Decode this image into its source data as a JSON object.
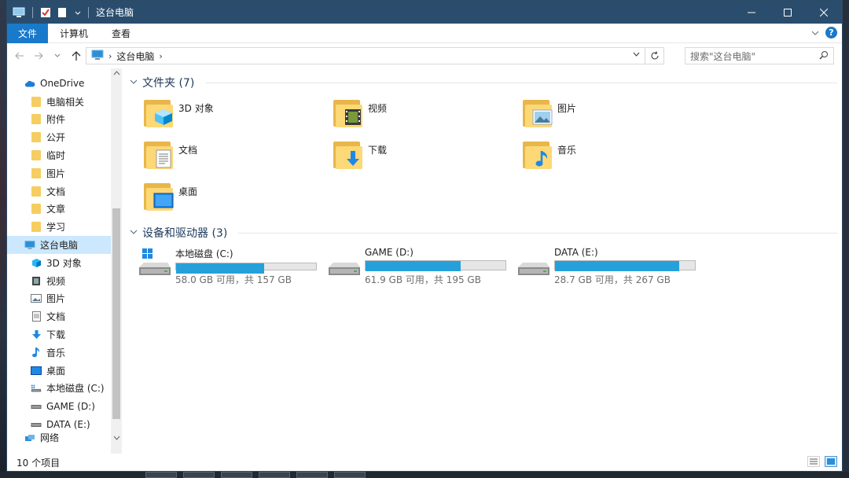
{
  "window": {
    "title": "这台电脑"
  },
  "ribbon": {
    "tabs": [
      {
        "label": "文件",
        "active": true
      },
      {
        "label": "计算机",
        "active": false
      },
      {
        "label": "查看",
        "active": false
      }
    ],
    "help_label": "?"
  },
  "address": {
    "crumb": "这台电脑",
    "search_placeholder": "搜索\"这台电脑\""
  },
  "sidebar": {
    "onedrive": "OneDrive",
    "onedrive_items": [
      "电脑相关",
      "附件",
      "公开",
      "临时",
      "图片",
      "文档",
      "文章",
      "学习"
    ],
    "thispc": "这台电脑",
    "thispc_items": [
      {
        "label": "3D 对象",
        "icon": "cube-icon"
      },
      {
        "label": "视频",
        "icon": "video-icon"
      },
      {
        "label": "图片",
        "icon": "picture-icon"
      },
      {
        "label": "文档",
        "icon": "document-icon"
      },
      {
        "label": "下载",
        "icon": "download-icon"
      },
      {
        "label": "音乐",
        "icon": "music-icon"
      },
      {
        "label": "桌面",
        "icon": "desktop-icon"
      },
      {
        "label": "本地磁盘 (C:)",
        "icon": "system-drive-icon"
      },
      {
        "label": "GAME (D:)",
        "icon": "drive-icon"
      },
      {
        "label": "DATA (E:)",
        "icon": "drive-icon"
      }
    ],
    "network": "网络"
  },
  "main": {
    "folders_header": "文件夹 (7)",
    "folders": [
      {
        "label": "3D 对象",
        "overlay": "cube-icon"
      },
      {
        "label": "视频",
        "overlay": "video-icon"
      },
      {
        "label": "图片",
        "overlay": "picture-icon"
      },
      {
        "label": "文档",
        "overlay": "document-icon"
      },
      {
        "label": "下载",
        "overlay": "download-icon"
      },
      {
        "label": "音乐",
        "overlay": "music-icon"
      },
      {
        "label": "桌面",
        "overlay": "desktop-icon"
      }
    ],
    "drives_header": "设备和驱动器 (3)",
    "drives": [
      {
        "label": "本地磁盘 (C:)",
        "free": "58.0 GB 可用，共 157 GB",
        "used_fraction": 0.63,
        "system": true
      },
      {
        "label": "GAME (D:)",
        "free": "61.9 GB 可用，共 195 GB",
        "used_fraction": 0.68,
        "system": false
      },
      {
        "label": "DATA (E:)",
        "free": "28.7 GB 可用，共 267 GB",
        "used_fraction": 0.89,
        "system": false
      }
    ]
  },
  "status": {
    "count": "10 个项目"
  },
  "colors": {
    "titlebar": "#2b4d6d",
    "accent": "#1979ca",
    "bar_fill": "#26a0da",
    "selected": "#cce8ff"
  }
}
